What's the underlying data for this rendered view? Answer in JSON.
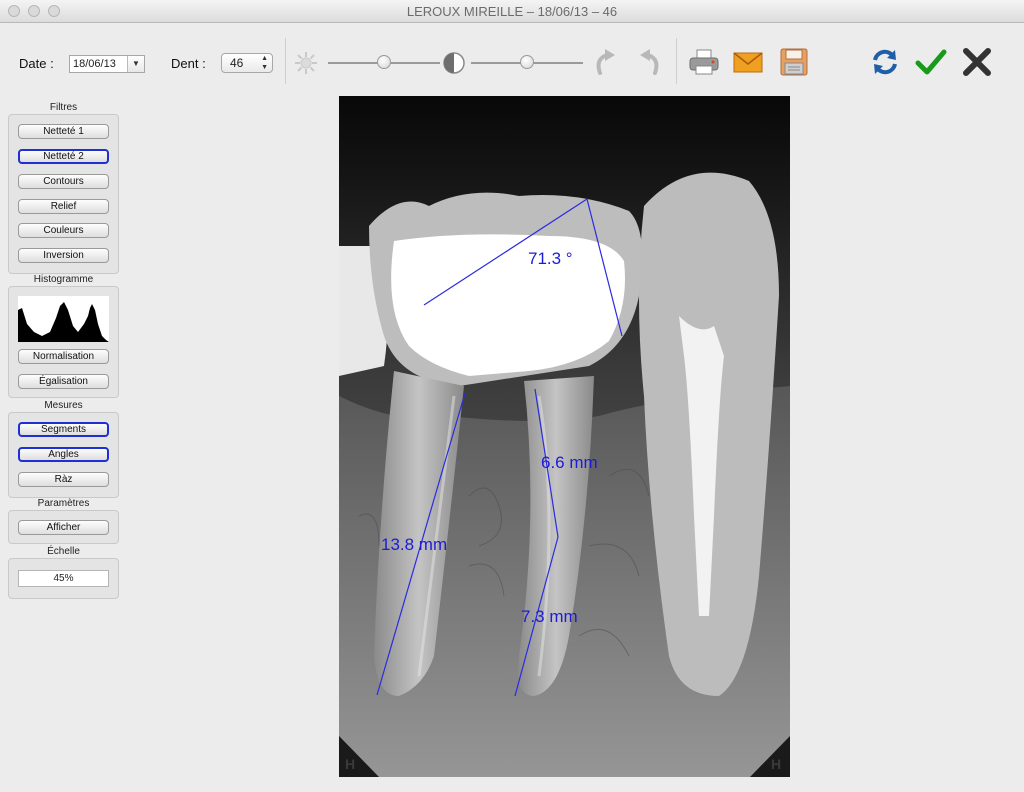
{
  "window": {
    "title": "LEROUX MIREILLE – 18/06/13 – 46"
  },
  "toolbar": {
    "date_label": "Date :",
    "date_value": "18/06/13",
    "tooth_label": "Dent :",
    "tooth_value": "46",
    "brightness_level": 0.5,
    "contrast_level": 0.5,
    "icons": [
      "brightness-icon",
      "contrast-icon",
      "rotate-right-icon",
      "rotate-left-icon",
      "print-icon",
      "email-icon",
      "save-icon",
      "refresh-icon",
      "validate-icon",
      "cancel-icon"
    ]
  },
  "sidebar": {
    "filters": {
      "title": "Filtres",
      "buttons": [
        "Netteté 1",
        "Netteté 2",
        "Contours",
        "Relief",
        "Couleurs",
        "Inversion"
      ],
      "active": "Netteté 2"
    },
    "histogram": {
      "title": "Histogramme",
      "buttons": [
        "Normalisation",
        "Égalisation"
      ]
    },
    "measures": {
      "title": "Mesures",
      "buttons": [
        "Segments",
        "Angles",
        "Ràz"
      ],
      "active": [
        "Segments",
        "Angles"
      ]
    },
    "settings": {
      "title": "Paramètres",
      "buttons": [
        "Afficher"
      ]
    },
    "scale": {
      "title": "Échelle",
      "value": "45%"
    }
  },
  "image": {
    "angle_label": "71.3 °",
    "seg1_label": "6.6 mm",
    "seg2_label": "13.8 mm",
    "seg3_label": "7.3 mm",
    "corner_marks": [
      "H",
      "H"
    ]
  },
  "colors": {
    "measure": "#1d1bd6",
    "active_border": "#1f2fd6",
    "validate": "#1a9a1a",
    "refresh": "#1e5fa8",
    "cancel": "#333333"
  }
}
